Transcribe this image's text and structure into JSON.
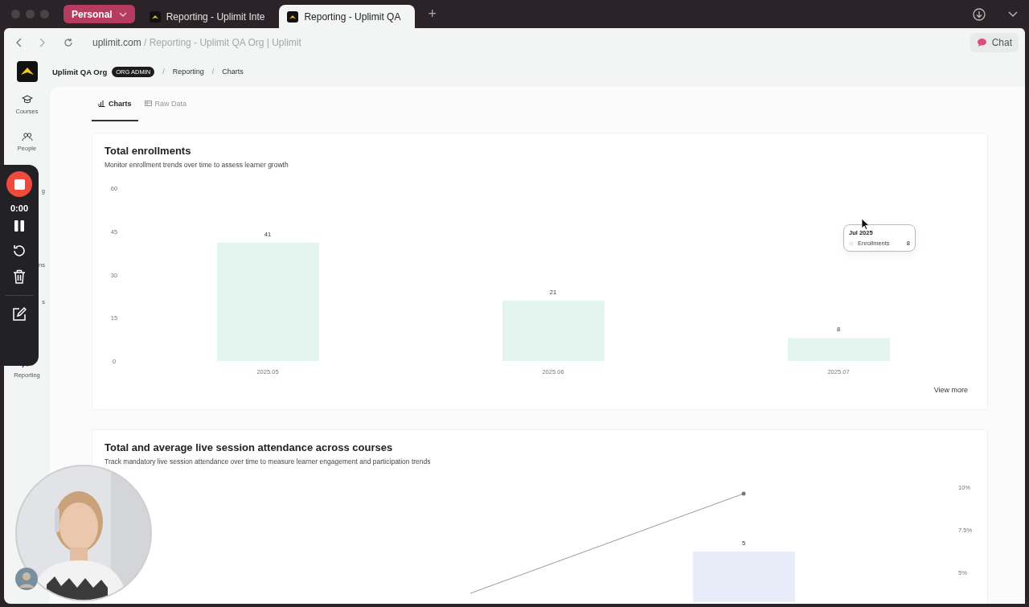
{
  "browser": {
    "profile": "Personal",
    "tabs": [
      {
        "title": "Reporting - Uplimit Inte",
        "selected": false
      },
      {
        "title": "Reporting - Uplimit QA",
        "selected": true
      }
    ],
    "new_tab": "+",
    "address": {
      "domain": "uplimit.com",
      "path": "/ Reporting - Uplimit QA Org | Uplimit"
    },
    "chat": "Chat"
  },
  "header": {
    "org": "Uplimit QA Org",
    "badge": "ORG ADMIN",
    "breadcrumbs": [
      "Reporting",
      "Charts"
    ],
    "separator": "/"
  },
  "sidebar": {
    "items": [
      {
        "kind": "full",
        "label": "Courses"
      },
      {
        "kind": "full",
        "label": "People"
      },
      {
        "kind": "covered",
        "label": "g"
      },
      {
        "kind": "covered"
      },
      {
        "kind": "covered",
        "label": "ns"
      },
      {
        "kind": "covered",
        "label": "s"
      },
      {
        "kind": "full",
        "label": "Reporting"
      }
    ]
  },
  "view_tabs": [
    {
      "label": "Charts",
      "selected": true
    },
    {
      "label": "Raw Data",
      "selected": false
    }
  ],
  "cards": [
    {
      "title": "Total enrollments",
      "subtitle": "Monitor enrollment trends over time to assess learner growth",
      "chart_data": {
        "type": "bar",
        "categories": [
          "2025.05",
          "2025.06",
          "2025.07"
        ],
        "series": [
          {
            "name": "Enrollments",
            "color": "#e4f4ee",
            "values": [
              41,
              21,
              8
            ]
          }
        ],
        "yticks": [
          0,
          15,
          30,
          45,
          60
        ],
        "ylim": [
          0,
          60
        ],
        "data_labels": true
      },
      "tooltip": {
        "title": "Jul 2025",
        "value": "8"
      },
      "link": "View more"
    },
    {
      "title": "Total and average live session attendance across courses",
      "subtitle": "Track mandatory live session attendance over time to measure learner engagement and participation trends",
      "axis_labels": [
        "10%",
        "7.5%",
        "5%"
      ],
      "bar": {
        "value_label": "5",
        "color": "#e8ebf8"
      }
    }
  ],
  "recorder": {
    "time": "0:00"
  }
}
